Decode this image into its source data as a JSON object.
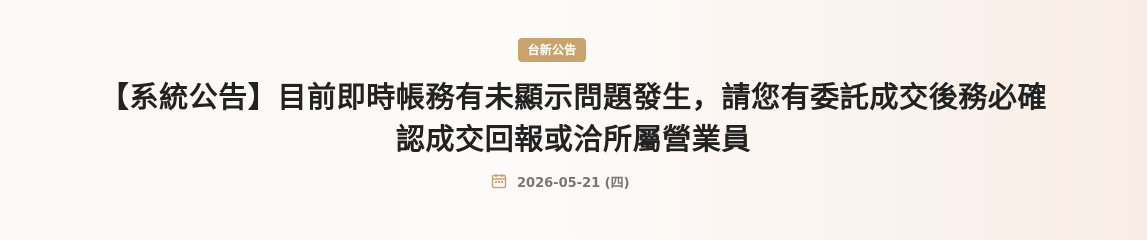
{
  "header": {
    "category_badge": "台新公告",
    "title_line1": "【系統公告】目前即時帳務有未顯示問題發生，請您有委託成交後務必確",
    "title_line2": "認成交回報或洽所屬營業員",
    "date": "2026-05-21 (四)",
    "accent_color": "#c8a36d",
    "calendar_icon": "calendar-icon"
  }
}
